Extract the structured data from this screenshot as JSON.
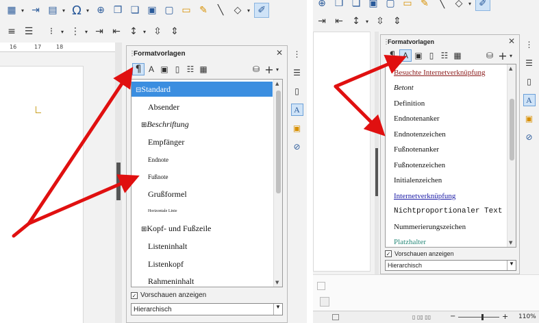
{
  "left_panel": {
    "toolbar_row1_icons": [
      "insert-table-icon",
      "insert-field-icon",
      "special-character-icon",
      "web-icon",
      "copy-icon",
      "paste-icon",
      "picture-icon",
      "comment-icon",
      "track-changes-icon",
      "line-icon",
      "shape-icon",
      "draw-icon"
    ],
    "special_char_glyph": "Ω",
    "ruler_marks": [
      "16",
      "17",
      "18"
    ],
    "sidebar": {
      "title": "Formatvorlagen",
      "close_glyph": "✕",
      "styles": [
        {
          "label": "Standard",
          "prefix": "⊟",
          "selected": true
        },
        {
          "label": "Absender"
        },
        {
          "label": "Beschriftung",
          "prefix": "⊞",
          "italic": true
        },
        {
          "label": "Empfänger"
        },
        {
          "label": "Endnote",
          "small": true
        },
        {
          "label": "Fußnote",
          "small": true
        },
        {
          "label": "Grußformel"
        },
        {
          "label": "Horizontale Linie",
          "tiny": true
        },
        {
          "label": "Kopf- und Fußzeile",
          "prefix": "⊞"
        },
        {
          "label": "Listeninhalt"
        },
        {
          "label": "Listenkopf"
        },
        {
          "label": "Rahmeninhalt"
        }
      ],
      "preview_label": "Vorschauen anzeigen",
      "preview_checked": true,
      "filter_value": "Hierarchisch"
    }
  },
  "right_panel": {
    "sidebar": {
      "title": "Formatvorlagen",
      "close_glyph": "✕",
      "styles": [
        {
          "label": "Besuchte Internetverknüpfung",
          "style": "visited"
        },
        {
          "label": "Betont",
          "style": "italic"
        },
        {
          "label": "Definition"
        },
        {
          "label": "Endnotenanker"
        },
        {
          "label": "Endnotenzeichen"
        },
        {
          "label": "Fußnotenanker"
        },
        {
          "label": "Fußnotenzeichen"
        },
        {
          "label": "Initialenzeichen"
        },
        {
          "label": "Internetverknüpfung",
          "style": "link"
        },
        {
          "label": "Nichtproportionaler Text",
          "style": "mono"
        },
        {
          "label": "Nummerierungszeichen"
        },
        {
          "label": "Platzhalter",
          "style": "teal"
        }
      ],
      "preview_label": "Vorschauen anzeigen",
      "preview_checked": true,
      "filter_value": "Hierarchisch"
    },
    "status": {
      "zoom": "110%"
    }
  },
  "colors": {
    "selection": "#3b8ee0",
    "annotation_arrow": "#e01010",
    "link": "#1a1aa6",
    "visited": "#8b1a1a",
    "teal": "#2a8a7a"
  }
}
